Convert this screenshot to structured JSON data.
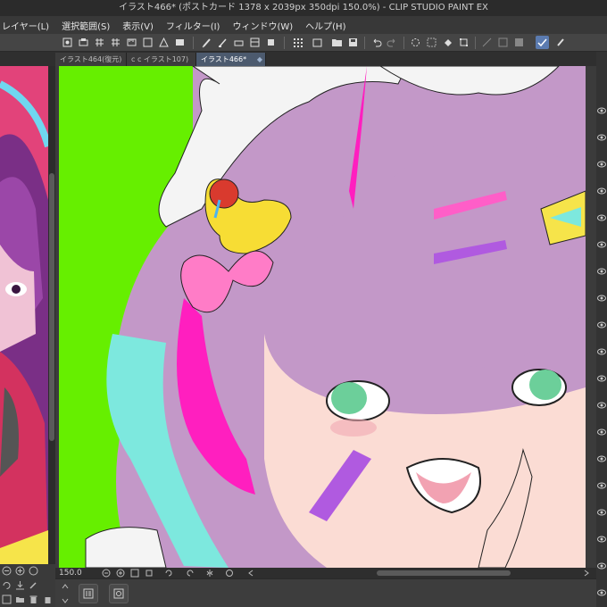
{
  "window": {
    "title": "イラスト466* (ポストカード 1378 x 2039px 350dpi 150.0%) - CLIP STUDIO PAINT EX"
  },
  "menu": {
    "items": [
      "レイヤー(L)",
      "選択範囲(S)",
      "表示(V)",
      "フィルター(I)",
      "ウィンドウ(W)",
      "ヘルプ(H)"
    ]
  },
  "tabs": [
    {
      "label": "イラスト464(復元)",
      "active": false
    },
    {
      "label": "c c イラスト107)",
      "active": false
    },
    {
      "label": "イラスト466*",
      "active": true,
      "close": "◆"
    }
  ],
  "status": {
    "zoom": "150.0"
  },
  "colors": {
    "accent": "#4c5a6e",
    "canvas_bg": "#66ef00",
    "hair": "#c398c8",
    "eye": "#6ccf9a",
    "magenta": "#ff1fbf",
    "ribbon_cyan": "#7de8de",
    "skin": "#fbdcd4",
    "left_art_bg": "#e2437a"
  },
  "icons": {
    "toolbar": [
      "brush-icon",
      "pen-icon",
      "eraser-icon",
      "layer-icon",
      "grid-icon",
      "folder-icon",
      "undo-icon",
      "redo-icon",
      "transform-icon",
      "select-icon",
      "fill-icon",
      "check-icon"
    ],
    "bottom": [
      "page-panel-icon",
      "navigator-icon"
    ]
  }
}
